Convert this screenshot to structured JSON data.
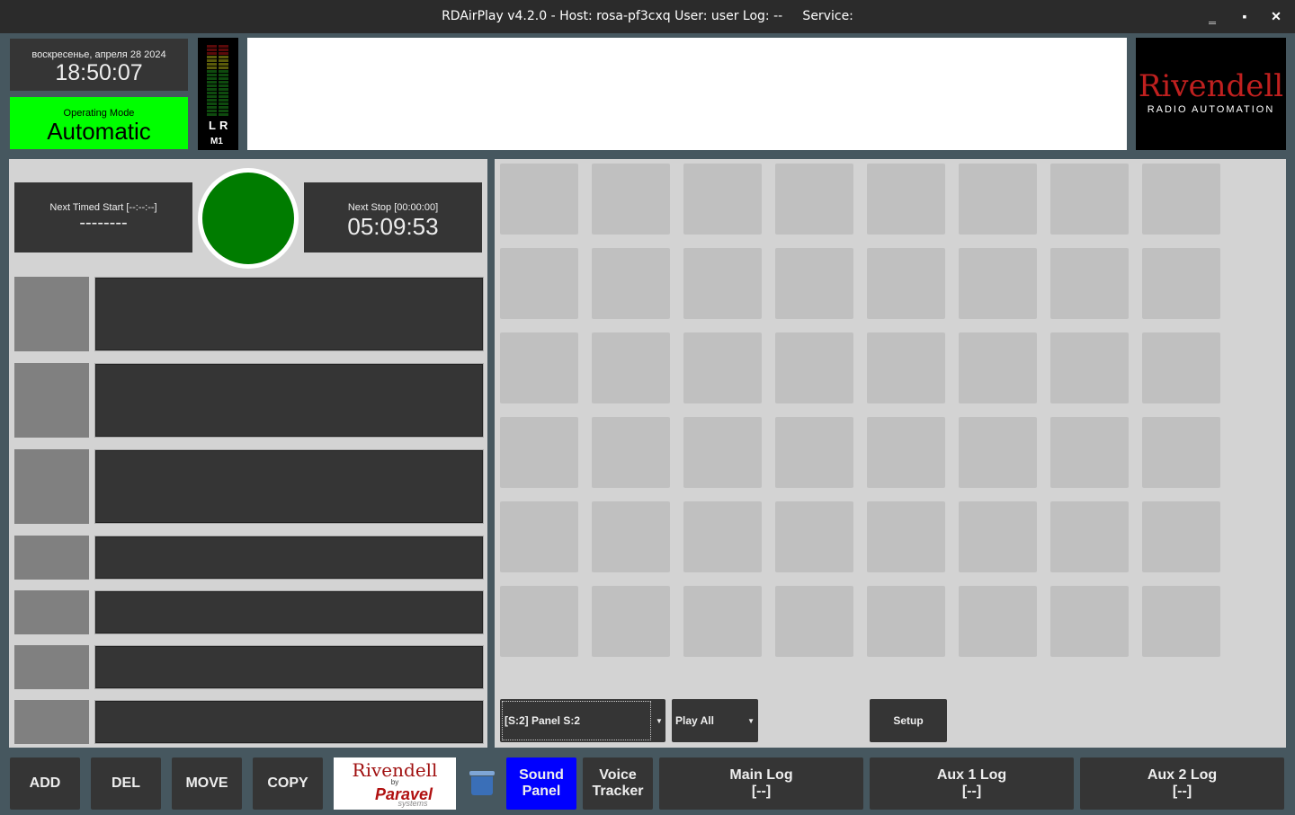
{
  "window": {
    "title": "RDAirPlay v4.2.0 - Host: rosa-pf3cxq User: user Log: --     Service:",
    "minimize": "‗",
    "maximize": "▪",
    "close": "✕"
  },
  "clock": {
    "date": "воскресенье, апреля 28 2024",
    "time": "18:50:07"
  },
  "mode": {
    "label": "Operating Mode",
    "value": "Automatic",
    "color": "#00ff00"
  },
  "meter": {
    "left": "L",
    "right": "R",
    "name": "M1"
  },
  "logo": {
    "title": "Rivendell",
    "subtitle": "RADIO AUTOMATION"
  },
  "timers": {
    "next_start_label": "Next Timed Start [--:--:--]",
    "next_start_value": "--------",
    "next_stop_label": "Next Stop [00:00:00]",
    "next_stop_value": "05:09:53"
  },
  "panel": {
    "selector": "[S:2] Panel S:2",
    "play_mode": "Play All",
    "setup": "Setup",
    "rows": 6,
    "cols": 8
  },
  "bottom": {
    "add": "ADD",
    "del": "DEL",
    "move": "MOVE",
    "copy": "COPY",
    "logo_title": "Rivendell",
    "logo_by": "by",
    "logo_paravel": "Paravel",
    "logo_systems": "systems",
    "sound_panel": "Sound Panel",
    "voice_tracker": "Voice Tracker",
    "main_log": "Main Log",
    "main_log_sub": "[--]",
    "aux1": "Aux 1 Log",
    "aux1_sub": "[--]",
    "aux2": "Aux 2 Log",
    "aux2_sub": "[--]"
  }
}
